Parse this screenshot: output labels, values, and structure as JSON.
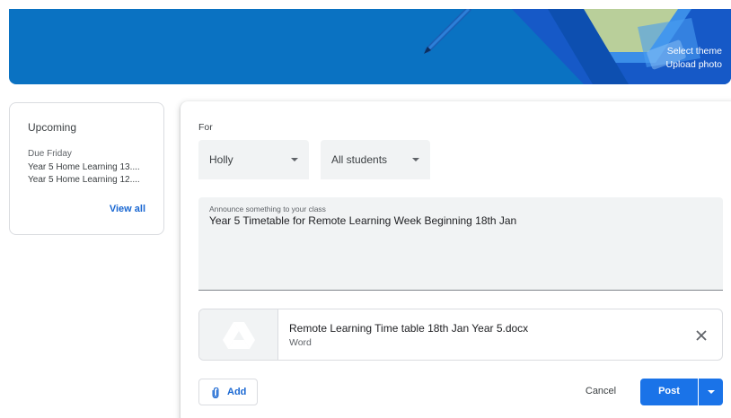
{
  "banner": {
    "select_theme": "Select theme",
    "upload_photo": "Upload photo",
    "background_color": "#0a72c2"
  },
  "upcoming": {
    "title": "Upcoming",
    "due_label": "Due Friday",
    "items": [
      "Year 5 Home Learning 13....",
      "Year 5 Home Learning 12...."
    ],
    "view_all": "View all"
  },
  "announce": {
    "for_label": "For",
    "class_select": "Holly",
    "students_select": "All students",
    "placeholder": "Announce something to your class",
    "text": "Year 5 Timetable for Remote Learning Week Beginning 18th Jan",
    "attachment": {
      "name": "Remote Learning Time table 18th Jan Year 5.docx",
      "type": "Word",
      "icon": "drive-icon"
    },
    "add_label": "Add",
    "cancel_label": "Cancel",
    "post_label": "Post"
  },
  "colors": {
    "accent": "#1a73e8",
    "link": "#1967d2"
  }
}
